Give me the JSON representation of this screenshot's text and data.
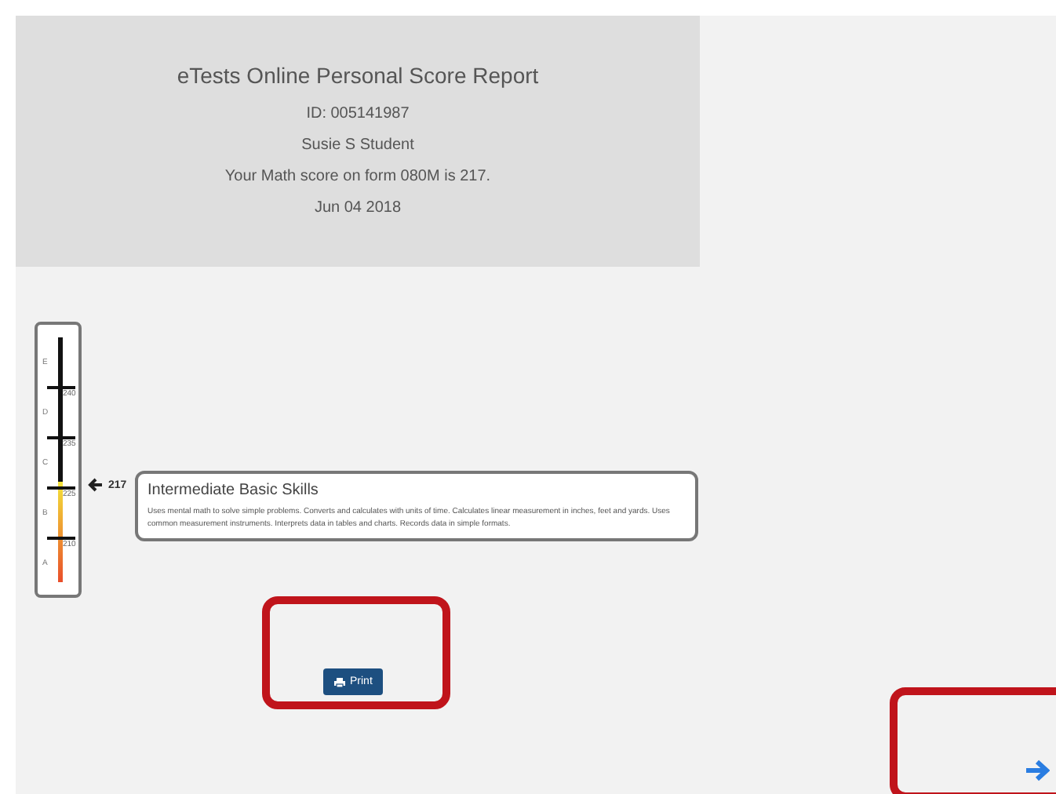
{
  "header": {
    "title": "eTests Online Personal Score Report",
    "lines": [
      "ID: 005141987",
      "Susie S Student",
      "Your Math score on form 080M is 217.",
      "Jun 04 2018"
    ]
  },
  "scale": {
    "bands": [
      "E",
      "D",
      "C",
      "B",
      "A"
    ],
    "ticks": [
      "240",
      "235",
      "225",
      "210"
    ],
    "level": 0.41,
    "score": "217"
  },
  "skill": {
    "title": "Intermediate Basic Skills",
    "description": "Uses mental math to solve simple problems. Converts and calculates with units of time. Calculates linear measurement in inches, feet and yards. Uses common measurement instruments. Interprets data in tables and charts. Records data in simple formats."
  },
  "print_button": "Print"
}
